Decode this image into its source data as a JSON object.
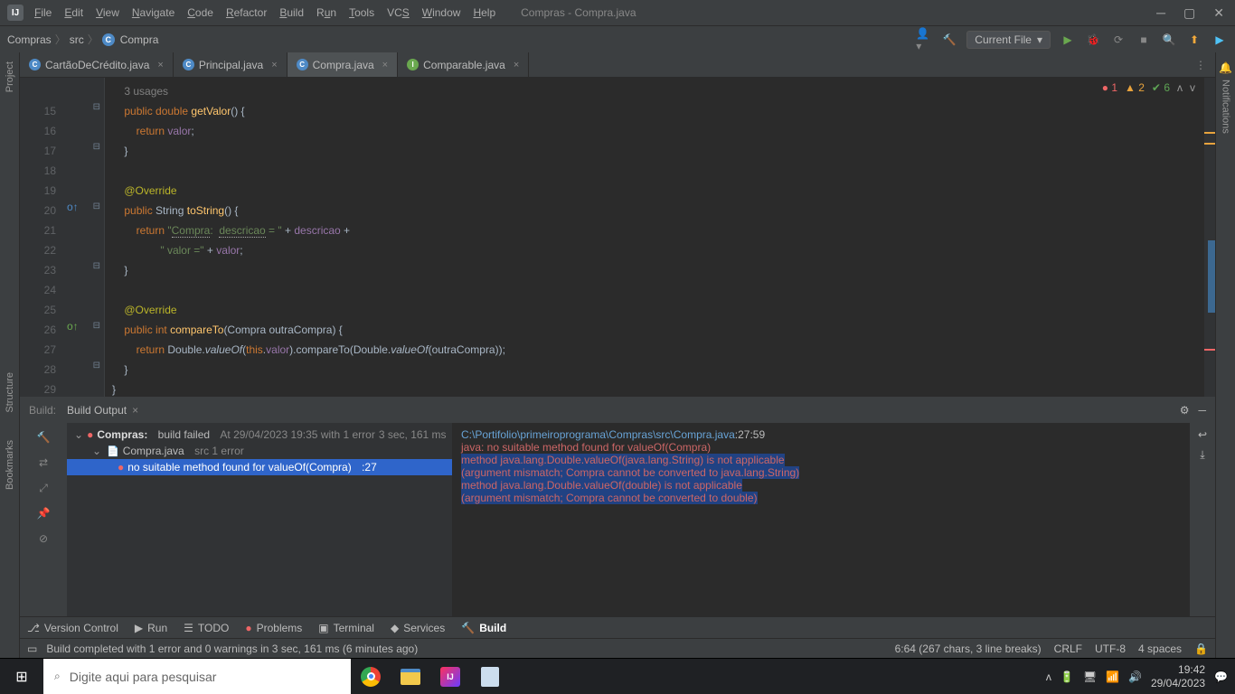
{
  "window": {
    "title": "Compras - Compra.java"
  },
  "menu": [
    "File",
    "Edit",
    "View",
    "Navigate",
    "Code",
    "Refactor",
    "Build",
    "Run",
    "Tools",
    "VCS",
    "Window",
    "Help"
  ],
  "breadcrumb": {
    "project": "Compras",
    "folder": "src",
    "file": "Compra"
  },
  "run_config": "Current File",
  "inspection": {
    "errors": "1",
    "warnings": "2",
    "oks": "6"
  },
  "tabs": [
    {
      "name": "CartãoDeCrédito.java",
      "icon": "blue",
      "active": false
    },
    {
      "name": "Principal.java",
      "icon": "blue",
      "active": false
    },
    {
      "name": "Compra.java",
      "icon": "blue",
      "active": true
    },
    {
      "name": "Comparable.java",
      "icon": "green",
      "active": false
    }
  ],
  "gutter_lines": [
    "",
    "15",
    "16",
    "17",
    "18",
    "19",
    "20",
    "21",
    "22",
    "23",
    "24",
    "25",
    "26",
    "27",
    "28",
    "29"
  ],
  "usages_hint": "3 usages",
  "build": {
    "tab_label": "Build:",
    "sub_label": "Build Output",
    "tree": {
      "root": {
        "name": "Compras:",
        "status": "build failed",
        "meta": "At 29/04/2023 19:35 with 1 error",
        "time": "3 sec, 161 ms"
      },
      "file": {
        "name": "Compra.java",
        "meta": "src 1 error"
      },
      "error": {
        "msg": "no suitable method found for valueOf(Compra)",
        "loc": ":27"
      }
    },
    "output": {
      "path": "C:\\Portifolio\\primeiroprograma\\Compras\\src\\Compra.java",
      "loc": ":27:59",
      "l1": "java: no suitable method found for valueOf(Compra)",
      "l2": "    method java.lang.Double.valueOf(java.lang.String) is not applicable",
      "l3": "      (argument mismatch; Compra cannot be converted to java.lang.String)",
      "l4": "    method java.lang.Double.valueOf(double) is not applicable",
      "l5": "      (argument mismatch; Compra cannot be converted to double)"
    }
  },
  "bottom_tools": [
    "Version Control",
    "Run",
    "TODO",
    "Problems",
    "Terminal",
    "Services",
    "Build"
  ],
  "status": {
    "msg": "Build completed with 1 error and 0 warnings in 3 sec, 161 ms (6 minutes ago)",
    "pos": "6:64 (267 chars, 3 line breaks)",
    "eol": "CRLF",
    "enc": "UTF-8",
    "indent": "4 spaces"
  },
  "taskbar": {
    "search_placeholder": "Digite aqui para pesquisar",
    "time": "19:42",
    "date": "29/04/2023"
  },
  "left_tools": [
    "Project",
    "Structure",
    "Bookmarks"
  ],
  "right_tools": [
    "Notifications"
  ]
}
